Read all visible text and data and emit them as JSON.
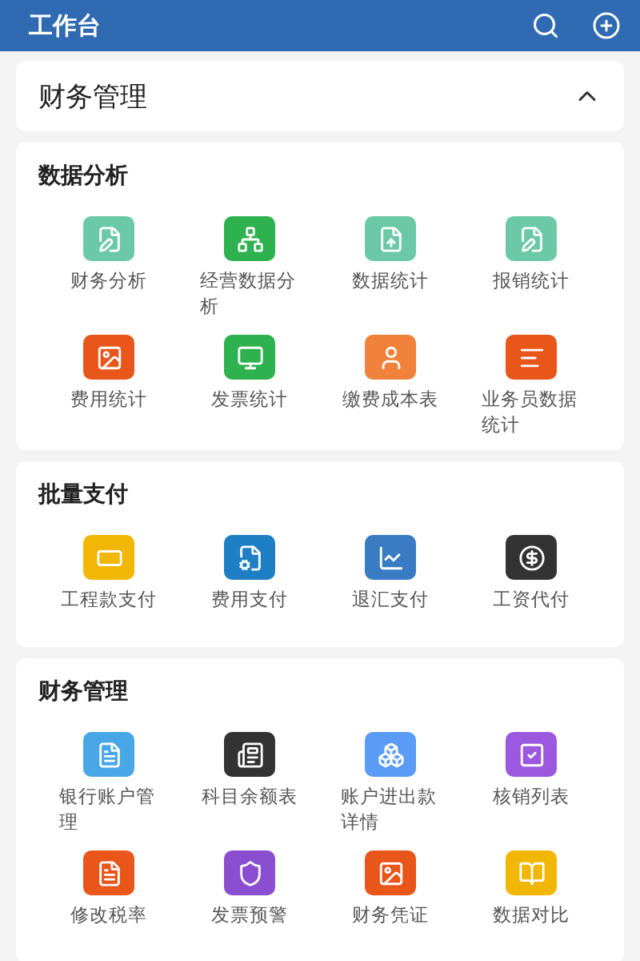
{
  "header": {
    "title": "工作台"
  },
  "module": {
    "title": "财务管理",
    "expanded": true
  },
  "sections": [
    {
      "title": "数据分析",
      "items": [
        {
          "label": "财务分析",
          "color": "#6cc9a8"
        },
        {
          "label": "经营数据分析",
          "color": "#2eb24f"
        },
        {
          "label": "数据统计",
          "color": "#6cc9a8"
        },
        {
          "label": "报销统计",
          "color": "#6cc9a8"
        },
        {
          "label": "费用统计",
          "color": "#e8561a"
        },
        {
          "label": "发票统计",
          "color": "#2eb24f"
        },
        {
          "label": "缴费成本表",
          "color": "#f0823c"
        },
        {
          "label": "业务员数据统计",
          "color": "#e8561a"
        }
      ]
    },
    {
      "title": "批量支付",
      "items": [
        {
          "label": "工程款支付",
          "color": "#f2b705"
        },
        {
          "label": "费用支付",
          "color": "#1e7fc4"
        },
        {
          "label": "退汇支付",
          "color": "#3a7cc4"
        },
        {
          "label": "工资代付",
          "color": "#333333"
        }
      ]
    },
    {
      "title": "财务管理",
      "items": [
        {
          "label": "银行账户管理",
          "color": "#49a7e8"
        },
        {
          "label": "科目余额表",
          "color": "#333333"
        },
        {
          "label": "账户进出款详情",
          "color": "#5a9cf5"
        },
        {
          "label": "核销列表",
          "color": "#9b59e0"
        },
        {
          "label": "修改税率",
          "color": "#e8561a"
        },
        {
          "label": "发票预警",
          "color": "#8a4fd1"
        },
        {
          "label": "财务凭证",
          "color": "#e8561a"
        },
        {
          "label": "数据对比",
          "color": "#f2b705"
        }
      ]
    }
  ]
}
